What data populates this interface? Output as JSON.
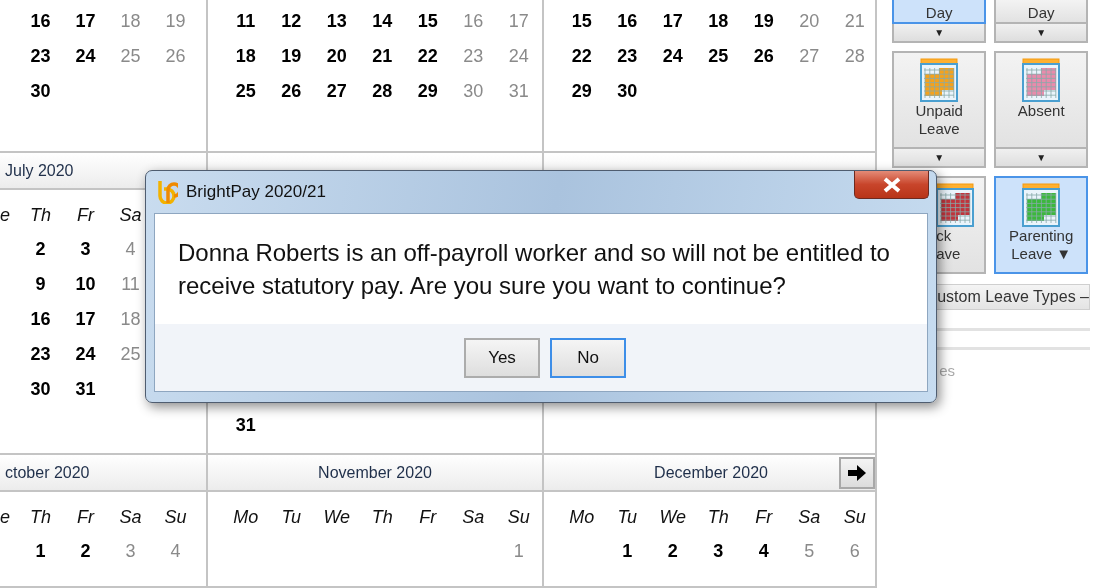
{
  "calendar": {
    "bands": [
      {
        "months": [
          {
            "header": false,
            "weeks": [
              [
                {
                  "d": "16",
                  "weekend": false
                },
                {
                  "d": "17",
                  "weekend": false
                },
                {
                  "d": "18",
                  "weekend": true
                },
                {
                  "d": "19",
                  "weekend": true
                }
              ],
              [
                {
                  "d": "23",
                  "weekend": false
                },
                {
                  "d": "24",
                  "weekend": false
                },
                {
                  "d": "25",
                  "weekend": true
                },
                {
                  "d": "26",
                  "weekend": true
                }
              ],
              [
                {
                  "d": "30",
                  "weekend": false
                }
              ]
            ]
          },
          {
            "header": false,
            "weeks": [
              [
                {
                  "d": "11",
                  "weekend": false
                },
                {
                  "d": "12",
                  "weekend": false
                },
                {
                  "d": "13",
                  "weekend": false
                },
                {
                  "d": "14",
                  "weekend": false
                },
                {
                  "d": "15",
                  "weekend": false
                },
                {
                  "d": "16",
                  "weekend": true
                },
                {
                  "d": "17",
                  "weekend": true
                }
              ],
              [
                {
                  "d": "18",
                  "weekend": false
                },
                {
                  "d": "19",
                  "weekend": false
                },
                {
                  "d": "20",
                  "weekend": false
                },
                {
                  "d": "21",
                  "weekend": false
                },
                {
                  "d": "22",
                  "weekend": false
                },
                {
                  "d": "23",
                  "weekend": true
                },
                {
                  "d": "24",
                  "weekend": true
                }
              ],
              [
                {
                  "d": "25",
                  "weekend": false
                },
                {
                  "d": "26",
                  "weekend": false
                },
                {
                  "d": "27",
                  "weekend": false
                },
                {
                  "d": "28",
                  "weekend": false
                },
                {
                  "d": "29",
                  "weekend": false
                },
                {
                  "d": "30",
                  "weekend": true
                },
                {
                  "d": "31",
                  "weekend": true
                }
              ]
            ]
          },
          {
            "header": false,
            "weeks": [
              [
                {
                  "d": "15",
                  "weekend": false
                },
                {
                  "d": "16",
                  "weekend": false
                },
                {
                  "d": "17",
                  "weekend": false
                },
                {
                  "d": "18",
                  "weekend": false
                },
                {
                  "d": "19",
                  "weekend": false
                },
                {
                  "d": "20",
                  "weekend": true
                },
                {
                  "d": "21",
                  "weekend": true
                }
              ],
              [
                {
                  "d": "22",
                  "weekend": false
                },
                {
                  "d": "23",
                  "weekend": false
                },
                {
                  "d": "24",
                  "weekend": false
                },
                {
                  "d": "25",
                  "weekend": false
                },
                {
                  "d": "26",
                  "weekend": false
                },
                {
                  "d": "27",
                  "weekend": true
                },
                {
                  "d": "28",
                  "weekend": true
                }
              ],
              [
                {
                  "d": "29",
                  "weekend": false
                },
                {
                  "d": "30",
                  "weekend": false
                }
              ]
            ]
          }
        ]
      },
      {
        "months": [
          {
            "header": true,
            "title": "July 2020",
            "weekdays": [
              "e",
              "Th",
              "Fr",
              "Sa"
            ],
            "weeks": [
              [
                {
                  "d": "2",
                  "weekend": false
                },
                {
                  "d": "3",
                  "weekend": false
                },
                {
                  "d": "4",
                  "weekend": true
                }
              ],
              [
                {
                  "d": "9",
                  "weekend": false
                },
                {
                  "d": "10",
                  "weekend": false
                },
                {
                  "d": "11",
                  "weekend": true
                }
              ],
              [
                {
                  "d": "16",
                  "weekend": false
                },
                {
                  "d": "17",
                  "weekend": false
                },
                {
                  "d": "18",
                  "weekend": true
                }
              ],
              [
                {
                  "d": "23",
                  "weekend": false
                },
                {
                  "d": "24",
                  "weekend": false
                },
                {
                  "d": "25",
                  "weekend": true
                }
              ],
              [
                {
                  "d": "30",
                  "weekend": false
                },
                {
                  "d": "31",
                  "weekend": false
                }
              ]
            ]
          },
          {
            "header": true,
            "covered": true,
            "weeks": [
              [
                {
                  "d": "31",
                  "weekend": false
                }
              ]
            ]
          },
          {
            "header": true
          }
        ]
      },
      {
        "months": [
          {
            "header": true,
            "title": "ctober 2020",
            "weekdays": [
              "e",
              "Th",
              "Fr",
              "Sa",
              "Su"
            ],
            "weeks": [
              [
                {
                  "d": "1",
                  "weekend": false
                },
                {
                  "d": "2",
                  "weekend": false
                },
                {
                  "d": "3",
                  "weekend": true
                },
                {
                  "d": "4",
                  "weekend": true
                }
              ]
            ]
          },
          {
            "header": true,
            "title": "November 2020",
            "weekdays": [
              "Mo",
              "Tu",
              "We",
              "Th",
              "Fr",
              "Sa",
              "Su"
            ],
            "weeks": [
              [
                {
                  "d": "1",
                  "weekend": true
                }
              ]
            ]
          },
          {
            "header": true,
            "title": "December 2020",
            "next_button": true,
            "weekdays": [
              "Mo",
              "Tu",
              "We",
              "Th",
              "Fr",
              "Sa",
              "Su"
            ],
            "weeks": [
              [
                {
                  "d": "1",
                  "weekend": false
                },
                {
                  "d": "2",
                  "weekend": false
                },
                {
                  "d": "3",
                  "weekend": false
                },
                {
                  "d": "4",
                  "weekend": false
                },
                {
                  "d": "5",
                  "weekend": true
                },
                {
                  "d": "6",
                  "weekend": true
                }
              ]
            ]
          }
        ]
      }
    ]
  },
  "leave_panel": {
    "rows": [
      [
        {
          "kind": "split",
          "lines": [
            "Day"
          ],
          "arrow": "▼",
          "selected": true
        },
        {
          "kind": "split",
          "lines": [
            "Day"
          ],
          "arrow": "▼",
          "selected": false
        }
      ],
      [
        {
          "kind": "split",
          "icon": true,
          "color": "#f5a21c",
          "lines": [
            "Unpaid",
            "Leave"
          ],
          "arrow": "▼",
          "selected": false
        },
        {
          "kind": "split",
          "icon": true,
          "color": "#e98bab",
          "lines": [
            "Absent"
          ],
          "arrow": "▼",
          "selected": false
        }
      ],
      [
        {
          "kind": "cut",
          "icon": true,
          "color": "#c0343c",
          "lines": [
            "ck",
            "ave"
          ],
          "selected": false
        },
        {
          "kind": "inline",
          "icon": true,
          "color": "#3cb83c",
          "lines": [
            "Parenting",
            "Leave"
          ],
          "arrow": "▼",
          "selected": true
        }
      ]
    ],
    "section": "ustom Leave Types –",
    "faded_label": "es"
  },
  "dialog": {
    "title": "BrightPay 2020/21",
    "message": "Donna Roberts is an off-payroll worker and so will not be entitled to receive statutory pay. Are you sure you want to continue?",
    "buttons": [
      {
        "label": "Yes",
        "focused": false
      },
      {
        "label": "No",
        "focused": true
      }
    ]
  }
}
